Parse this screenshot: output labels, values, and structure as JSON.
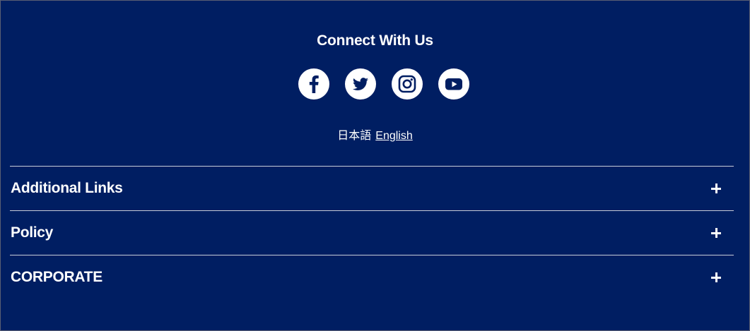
{
  "connect": {
    "title": "Connect With Us",
    "social": [
      {
        "name": "facebook-icon"
      },
      {
        "name": "twitter-icon"
      },
      {
        "name": "instagram-icon"
      },
      {
        "name": "youtube-icon"
      }
    ]
  },
  "language": {
    "japanese": "日本語",
    "english": "English"
  },
  "accordion": {
    "items": [
      {
        "label": "Additional Links"
      },
      {
        "label": "Policy"
      },
      {
        "label": "CORPORATE"
      }
    ]
  },
  "colors": {
    "background": "#001e62",
    "foreground": "#ffffff",
    "divider": "#c9ccd8"
  }
}
